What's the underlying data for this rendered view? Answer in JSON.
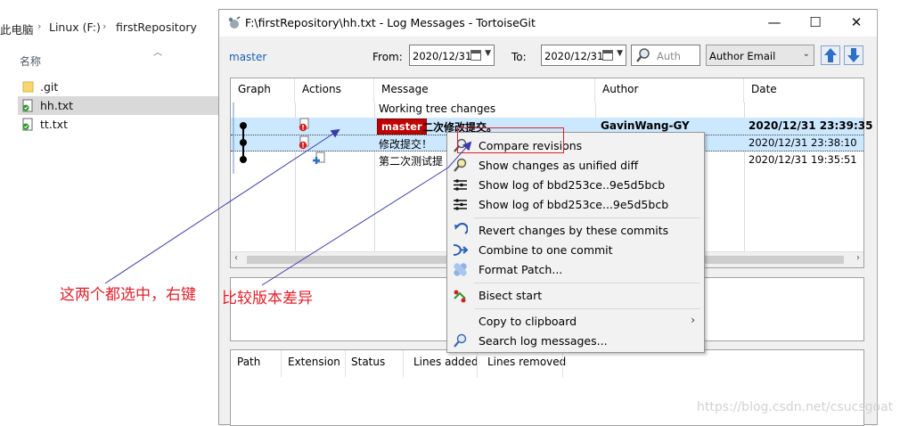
{
  "explorer": {
    "breadcrumb": [
      "此电脑",
      "Linux (F:)",
      "firstRepository"
    ],
    "column_header": "名称",
    "files": [
      {
        "name": ".git",
        "icon": "folder-icon",
        "selected": false
      },
      {
        "name": "hh.txt",
        "icon": "git-file-icon",
        "selected": true
      },
      {
        "name": "tt.txt",
        "icon": "git-file-icon",
        "selected": false
      }
    ]
  },
  "window": {
    "title": "F:\\firstRepository\\hh.txt - Log Messages - TortoiseGit",
    "minimize": "—",
    "maximize": "☐",
    "close": "✕"
  },
  "toolbar": {
    "branch_link": "master",
    "from_label": "From:",
    "from_date": "2020/12/31",
    "to_label": "To:",
    "to_date": "2020/12/31",
    "search_placeholder": "Auth",
    "filter_field": "Author Email"
  },
  "log": {
    "columns": [
      "Graph",
      "Actions",
      "Message",
      "Author",
      "Date"
    ],
    "working_tree": "Working tree changes",
    "rows": [
      {
        "badge": "master",
        "message": "二次修改提交。",
        "author": "GavinWang-GY",
        "date": "2020/12/31 23:39:35",
        "bold": true
      },
      {
        "badge": "",
        "message": "修改提交！",
        "author": "",
        "date": "2020/12/31 23:38:10",
        "bold": false
      },
      {
        "badge": "",
        "message": "第二次测试提",
        "author": "",
        "date": "2020/12/31 19:35:51",
        "bold": false
      }
    ]
  },
  "files_panel": {
    "columns": [
      "Path",
      "Extension",
      "Status",
      "Lines added",
      "Lines removed"
    ]
  },
  "context_menu": {
    "items": [
      {
        "label": "Compare revisions",
        "icon": "compare-icon"
      },
      {
        "label": "Show changes as unified diff",
        "icon": "diff-icon"
      },
      {
        "label": "Show log of bbd253ce..9e5d5bcb",
        "icon": "log-icon"
      },
      {
        "label": "Show log of bbd253ce...9e5d5bcb",
        "icon": "log-icon"
      },
      {
        "label": "Revert changes by these commits",
        "icon": "revert-icon"
      },
      {
        "label": "Combine to one commit",
        "icon": "combine-icon"
      },
      {
        "label": "Format Patch...",
        "icon": "patch-icon"
      },
      {
        "label": "Bisect start",
        "icon": "bisect-icon"
      },
      {
        "label": "Copy to clipboard",
        "icon": "",
        "submenu": "›"
      },
      {
        "label": "Search log messages...",
        "icon": "search-icon"
      }
    ]
  },
  "annotations": {
    "left": "这两个都选中，右键",
    "right": "比较版本差异"
  },
  "watermark": "https://blog.csdn.net/csucsgoat",
  "colors": {
    "accent_red": "#e0202a",
    "selection_blue": "#cce8ff",
    "badge_red": "#c00000",
    "link_blue": "#1a5fb4",
    "arrow_blue": "#3c3ca8"
  }
}
